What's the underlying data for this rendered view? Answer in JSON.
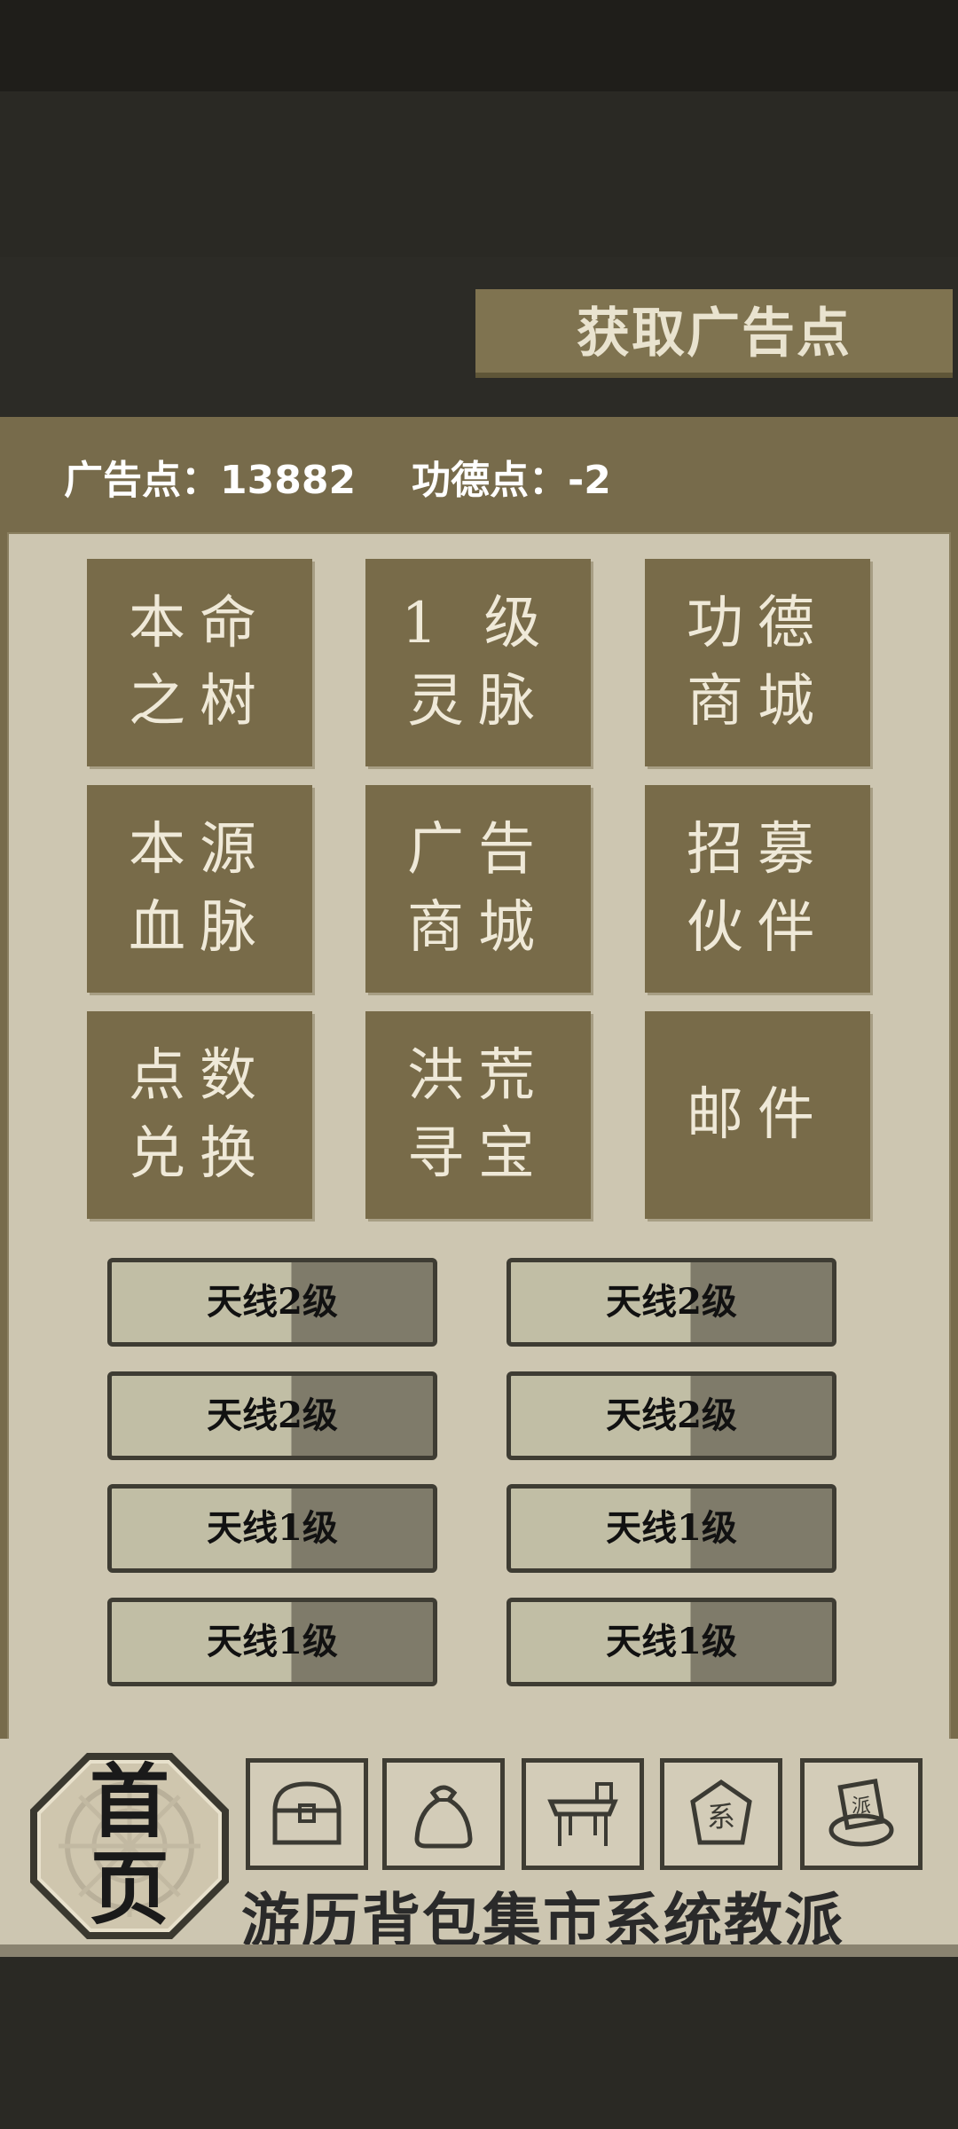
{
  "header": {
    "get_ad_points_label": "获取广告点"
  },
  "stats": {
    "ad_points_label": "广告点：13882",
    "merit_points_label": "功德点：-2"
  },
  "tiles": [
    {
      "label": "本命\n之树"
    },
    {
      "label": "1 级\n灵脉"
    },
    {
      "label": "功德\n商城"
    },
    {
      "label": "本源\n血脉"
    },
    {
      "label": "广告\n商城"
    },
    {
      "label": "招募\n伙伴"
    },
    {
      "label": "点数\n兑换"
    },
    {
      "label": "洪荒\n寻宝"
    },
    {
      "label": "邮件"
    }
  ],
  "antenna_buttons": [
    {
      "label": "天线2级"
    },
    {
      "label": "天线2级"
    },
    {
      "label": "天线2级"
    },
    {
      "label": "天线2级"
    },
    {
      "label": "天线1级"
    },
    {
      "label": "天线1级"
    },
    {
      "label": "天线1级"
    },
    {
      "label": "天线1级"
    }
  ],
  "bottom_nav": {
    "home_label": "首\n页",
    "labels_line": "游历背包集市系统教派",
    "items": [
      {
        "label": "游历",
        "icon": "chest-icon"
      },
      {
        "label": "背包",
        "icon": "bag-icon"
      },
      {
        "label": "集市",
        "icon": "stall-icon"
      },
      {
        "label": "系统",
        "icon": "system-icon"
      },
      {
        "label": "教派",
        "icon": "sect-icon"
      }
    ]
  },
  "colors": {
    "tile": "#786b49",
    "panel": "#cdc6b1",
    "accent": "#7f7350"
  }
}
